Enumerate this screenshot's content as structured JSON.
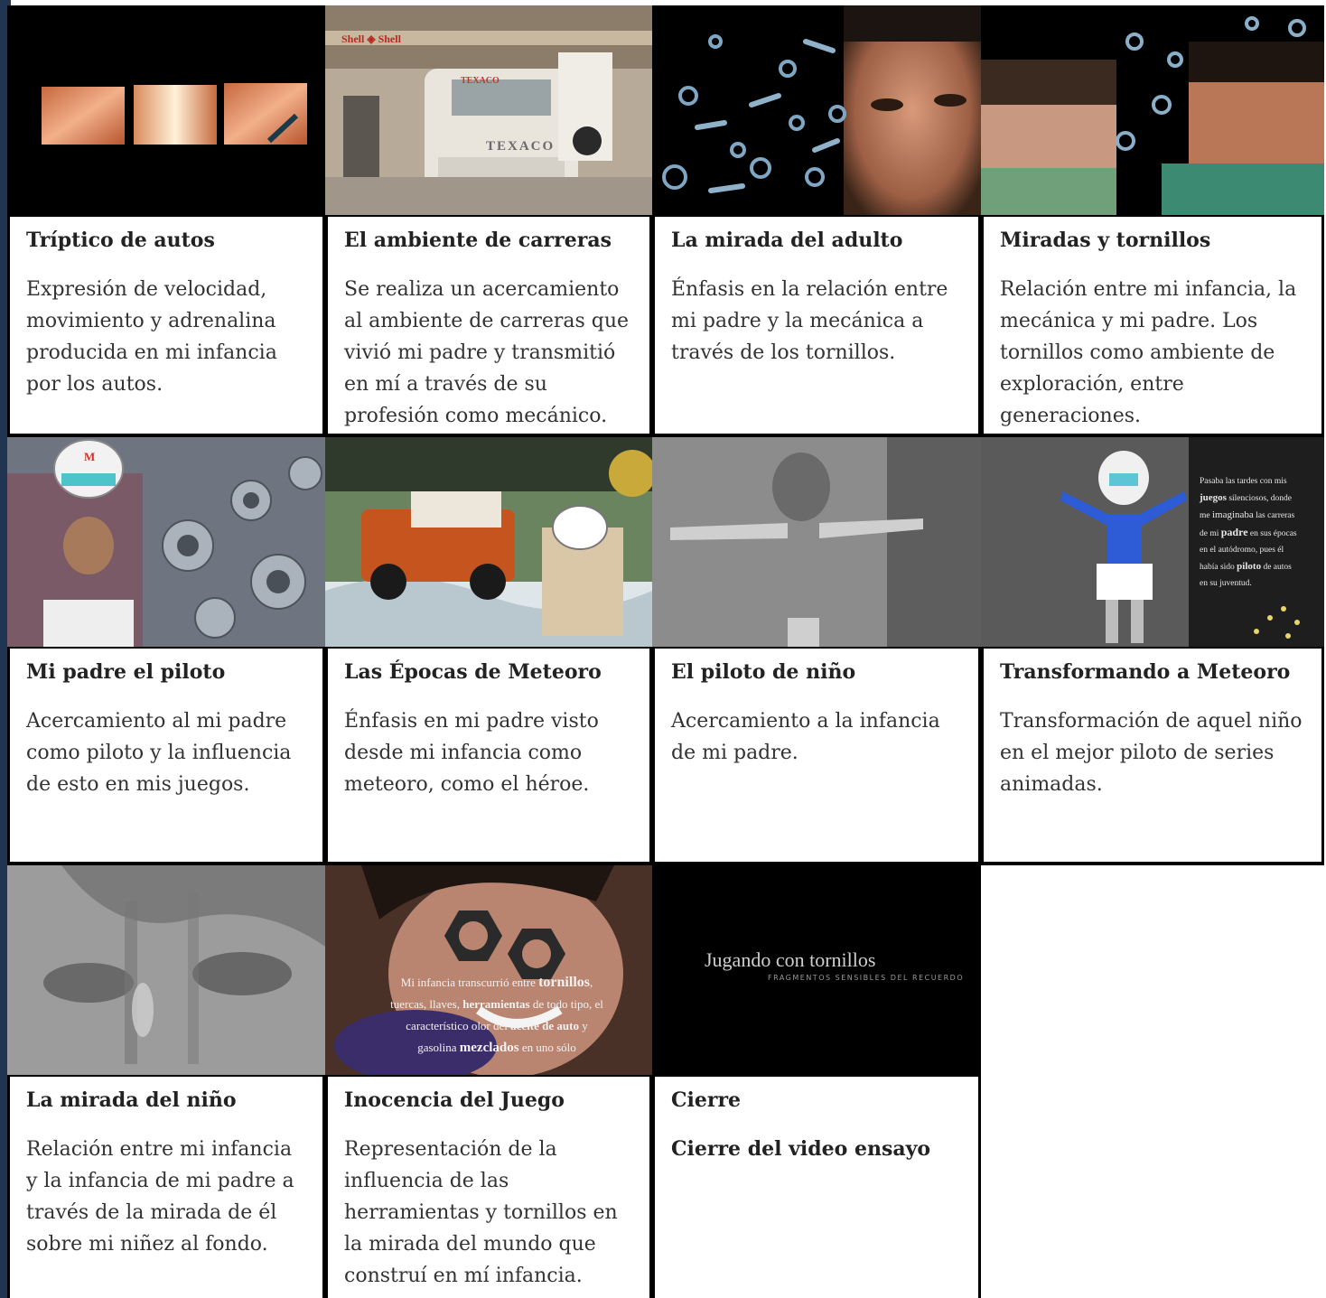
{
  "panels": [
    {
      "title": "Tríptico  de autos",
      "description": "Expresión de velocidad, movimiento y adrenalina producida en mi infancia por los autos."
    },
    {
      "title": "El ambiente de carreras",
      "description": "Se realiza un acercamiento al ambiente de carreras que vivió mi padre y transmitió en mí a través de su profesión como mecánico.",
      "image_text": {
        "banner": "Shell ◈ Shell",
        "sponsor_a": "TEXACO",
        "sponsor_b": "TEXACO"
      }
    },
    {
      "title": "La mirada del adulto",
      "description": "Énfasis en la relación entre mi padre y la mecánica a través de los tornillos."
    },
    {
      "title": "Miradas y tornillos",
      "description": "Relación entre mi infancia, la mecánica y mi padre. Los tornillos como ambiente de exploración, entre generaciones."
    },
    {
      "title": "Mi padre el piloto",
      "description": "Acercamiento al mi padre como piloto y la  influencia de esto en mis juegos.",
      "image_text": {
        "helmet_letter": "M"
      }
    },
    {
      "title": "Las Épocas de Meteoro",
      "description": "Énfasis en mi padre visto desde mi infancia como meteoro, como el héroe."
    },
    {
      "title": "El piloto de niño",
      "description": "Acercamiento a la infancia de mi padre."
    },
    {
      "title": "Transformando a Meteoro",
      "description": "Transformación de aquel niño en el mejor piloto de series animadas.",
      "image_text": {
        "l1": "Pasaba las tardes con  mis",
        "l2": "juegos",
        "l2b": " silenciosos, donde",
        "l3": "me ",
        "l3b": "imaginaba",
        "l3c": " las carreras",
        "l4": "de mi ",
        "l4b": "padre",
        "l4c": " en sus épocas",
        "l5": "en el autódromo, pues él",
        "l6": "había sido ",
        "l6b": "piloto",
        "l6c": " de autos",
        "l7": "en su juventud."
      }
    },
    {
      "title": "La mirada del niño",
      "description": "Relación entre mi infancia y la infancia de mi padre a través de la mirada de él sobre mi niñez al fondo."
    },
    {
      "title": "Inocencia del Juego",
      "description": "Representación de la influencia de las herramientas y tornillos en la mirada del mundo que construí en mí infancia.",
      "image_text": {
        "a1": "Mi infancia transcurrió entre ",
        "a1b": "tornillos",
        "a1c": ",",
        "a2": "tuercas, llaves, ",
        "a2b": "herramientas",
        "a2c": " de todo tipo, el",
        "a3": "característico olor del ",
        "a3b": "aceite de auto",
        "a3c": " y",
        "a4": "gasolina ",
        "a4b": "mezclados",
        "a4c": " en uno sólo"
      }
    },
    {
      "title": "Cierre",
      "description": "Cierre del video ensayo",
      "image_text": {
        "main": "Jugando con tornillos",
        "sub": "FRAGMENTOS SENSIBLES DEL RECUERDO"
      }
    }
  ],
  "colors": {
    "background": "#ffffff",
    "grid_border": "#0a0a0a",
    "left_strip": "#1f3552",
    "text": "#222222"
  }
}
